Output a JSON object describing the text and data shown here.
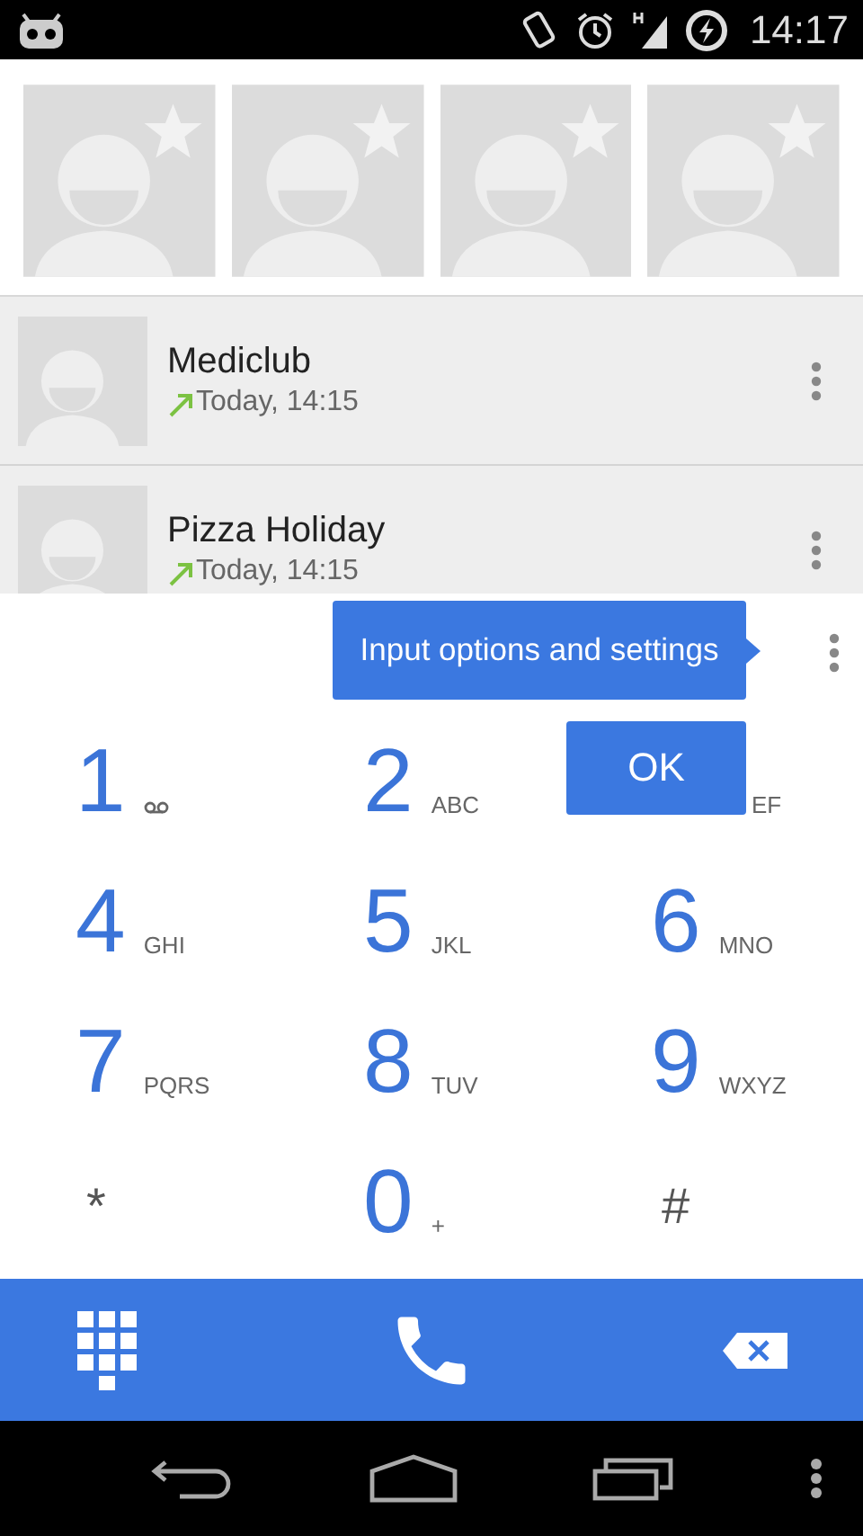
{
  "status_bar": {
    "time": "14:17"
  },
  "favorites": [
    {
      "starred": true
    },
    {
      "starred": true
    },
    {
      "starred": true
    },
    {
      "starred": true
    }
  ],
  "call_log": [
    {
      "name": "Mediclub",
      "time": "Today, 14:15",
      "kind": "outgoing"
    },
    {
      "name": "Pizza Holiday",
      "time": "Today, 14:15",
      "kind": "outgoing"
    }
  ],
  "tooltip": {
    "text": "Input options and settings",
    "button": "OK"
  },
  "dialpad": [
    {
      "kind": "voicemail",
      "digit": "1"
    },
    {
      "kind": "digit",
      "digit": "2",
      "letters": "ABC"
    },
    {
      "kind": "covered",
      "letters": "EF"
    },
    {
      "kind": "digit",
      "digit": "4",
      "letters": "GHI"
    },
    {
      "kind": "digit",
      "digit": "5",
      "letters": "JKL"
    },
    {
      "kind": "digit",
      "digit": "6",
      "letters": "MNO"
    },
    {
      "kind": "digit",
      "digit": "7",
      "letters": "PQRS"
    },
    {
      "kind": "digit",
      "digit": "8",
      "letters": "TUV"
    },
    {
      "kind": "digit",
      "digit": "9",
      "letters": "WXYZ"
    },
    {
      "kind": "symbol",
      "digit": "*"
    },
    {
      "kind": "digit",
      "digit": "0",
      "letters": "+"
    },
    {
      "kind": "symbol",
      "digit": "#"
    }
  ]
}
